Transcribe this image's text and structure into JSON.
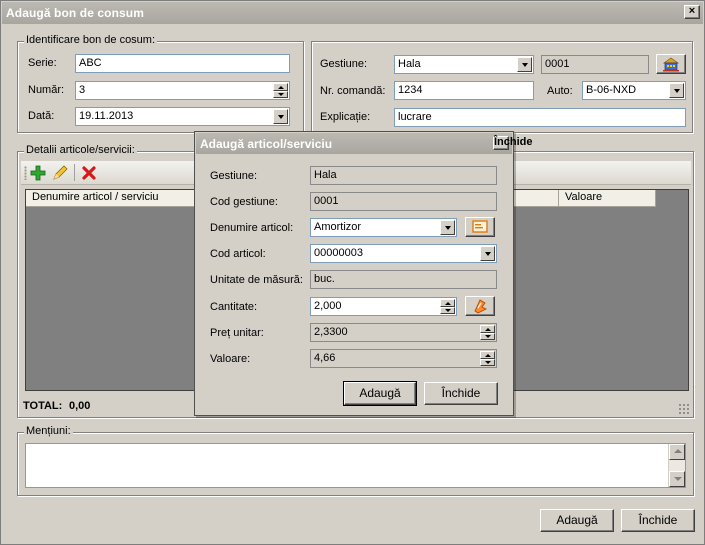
{
  "window": {
    "title": "Adaugă bon de consum",
    "close": "×"
  },
  "ident": {
    "legend": "Identificare bon de cosum:",
    "serie_label": "Serie:",
    "serie": "ABC",
    "numar_label": "Număr:",
    "numar": "3",
    "data_label": "Dată:",
    "data": "19.11.2013"
  },
  "right": {
    "gestiune_label": "Gestiune:",
    "gestiune": "Hala",
    "gestiune_cod": "0001",
    "comanda_label": "Nr. comandă:",
    "comanda": "1234",
    "auto_label": "Auto:",
    "auto": "B-06-NXD",
    "explicatie_label": "Explicație:",
    "explicatie": "lucrare"
  },
  "details": {
    "legend": "Detalii articole/servicii:",
    "columns": [
      "Denumire articol / serviciu",
      "Valoare"
    ],
    "total_label": "TOTAL:",
    "total": "0,00"
  },
  "mentiuni": {
    "legend": "Mențiuni:"
  },
  "footer": {
    "add": "Adaugă",
    "close": "Închide"
  },
  "dialog": {
    "title": "Adaugă articol/serviciu",
    "close": "Închide",
    "gestiune_label": "Gestiune:",
    "gestiune": "Hala",
    "cod_gestiune_label": "Cod gestiune:",
    "cod_gestiune": "0001",
    "denumire_label": "Denumire articol:",
    "denumire": "Amortizor",
    "cod_articol_label": "Cod articol:",
    "cod_articol": "00000003",
    "um_label": "Unitate de măsură:",
    "um": "buc.",
    "cantitate_label": "Cantitate:",
    "cantitate": "2,000",
    "pret_label": "Preț unitar:",
    "pret": "2,3300",
    "valoare_label": "Valoare:",
    "valoare": "4,66",
    "add": "Adaugă"
  },
  "colors": {
    "title_bar": "#a9a59f",
    "window_bg": "#d4d0c8",
    "grid_bg": "#808080",
    "field_border": "#7f9db9"
  },
  "icons": [
    "warehouse-icon",
    "add-icon",
    "edit-icon",
    "delete-icon",
    "note-icon",
    "calculator-icon"
  ]
}
